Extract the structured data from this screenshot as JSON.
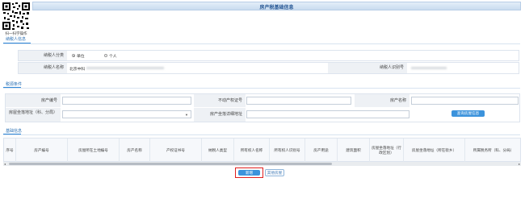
{
  "header": {
    "title": "房产税基础信息"
  },
  "qr": {
    "caption": "扫一扫学操作"
  },
  "sections": {
    "taxpayer": "纳税人信息",
    "source": "税源条件",
    "list": "基础信息"
  },
  "taxpayer": {
    "category_label": "纳税人分类",
    "category_options": [
      "单位",
      "个人"
    ],
    "name_label": "纳税人名称",
    "name_value": "北京中科",
    "id_label": "纳税人识别号"
  },
  "conditions": {
    "house_no_label": "房产编号",
    "cert_label": "不动产权证号",
    "house_name_label": "房产名称",
    "tax_office_label": "房屋坐落地址（科、分局）",
    "address_label": "房产坐落详细地址",
    "query_button": "查询房屋信息"
  },
  "grid": {
    "columns": [
      "序号",
      "房产编号",
      "房屋所在土地编号",
      "房产名称",
      "产权证书号",
      "纳税人类型",
      "所有权人名称",
      "所有权人识别号",
      "房产用途",
      "建筑面积",
      "房屋坐落地址（行政区划）",
      "房屋坐落地址（所在街乡）",
      "所属税务所（科、分局）"
    ]
  },
  "actions": {
    "add_button": "新增",
    "other_button": "其他房屋"
  },
  "colors": {
    "accent": "#2f86d6",
    "header_bg": "#c9dcf0",
    "highlight_border": "#e02020"
  }
}
